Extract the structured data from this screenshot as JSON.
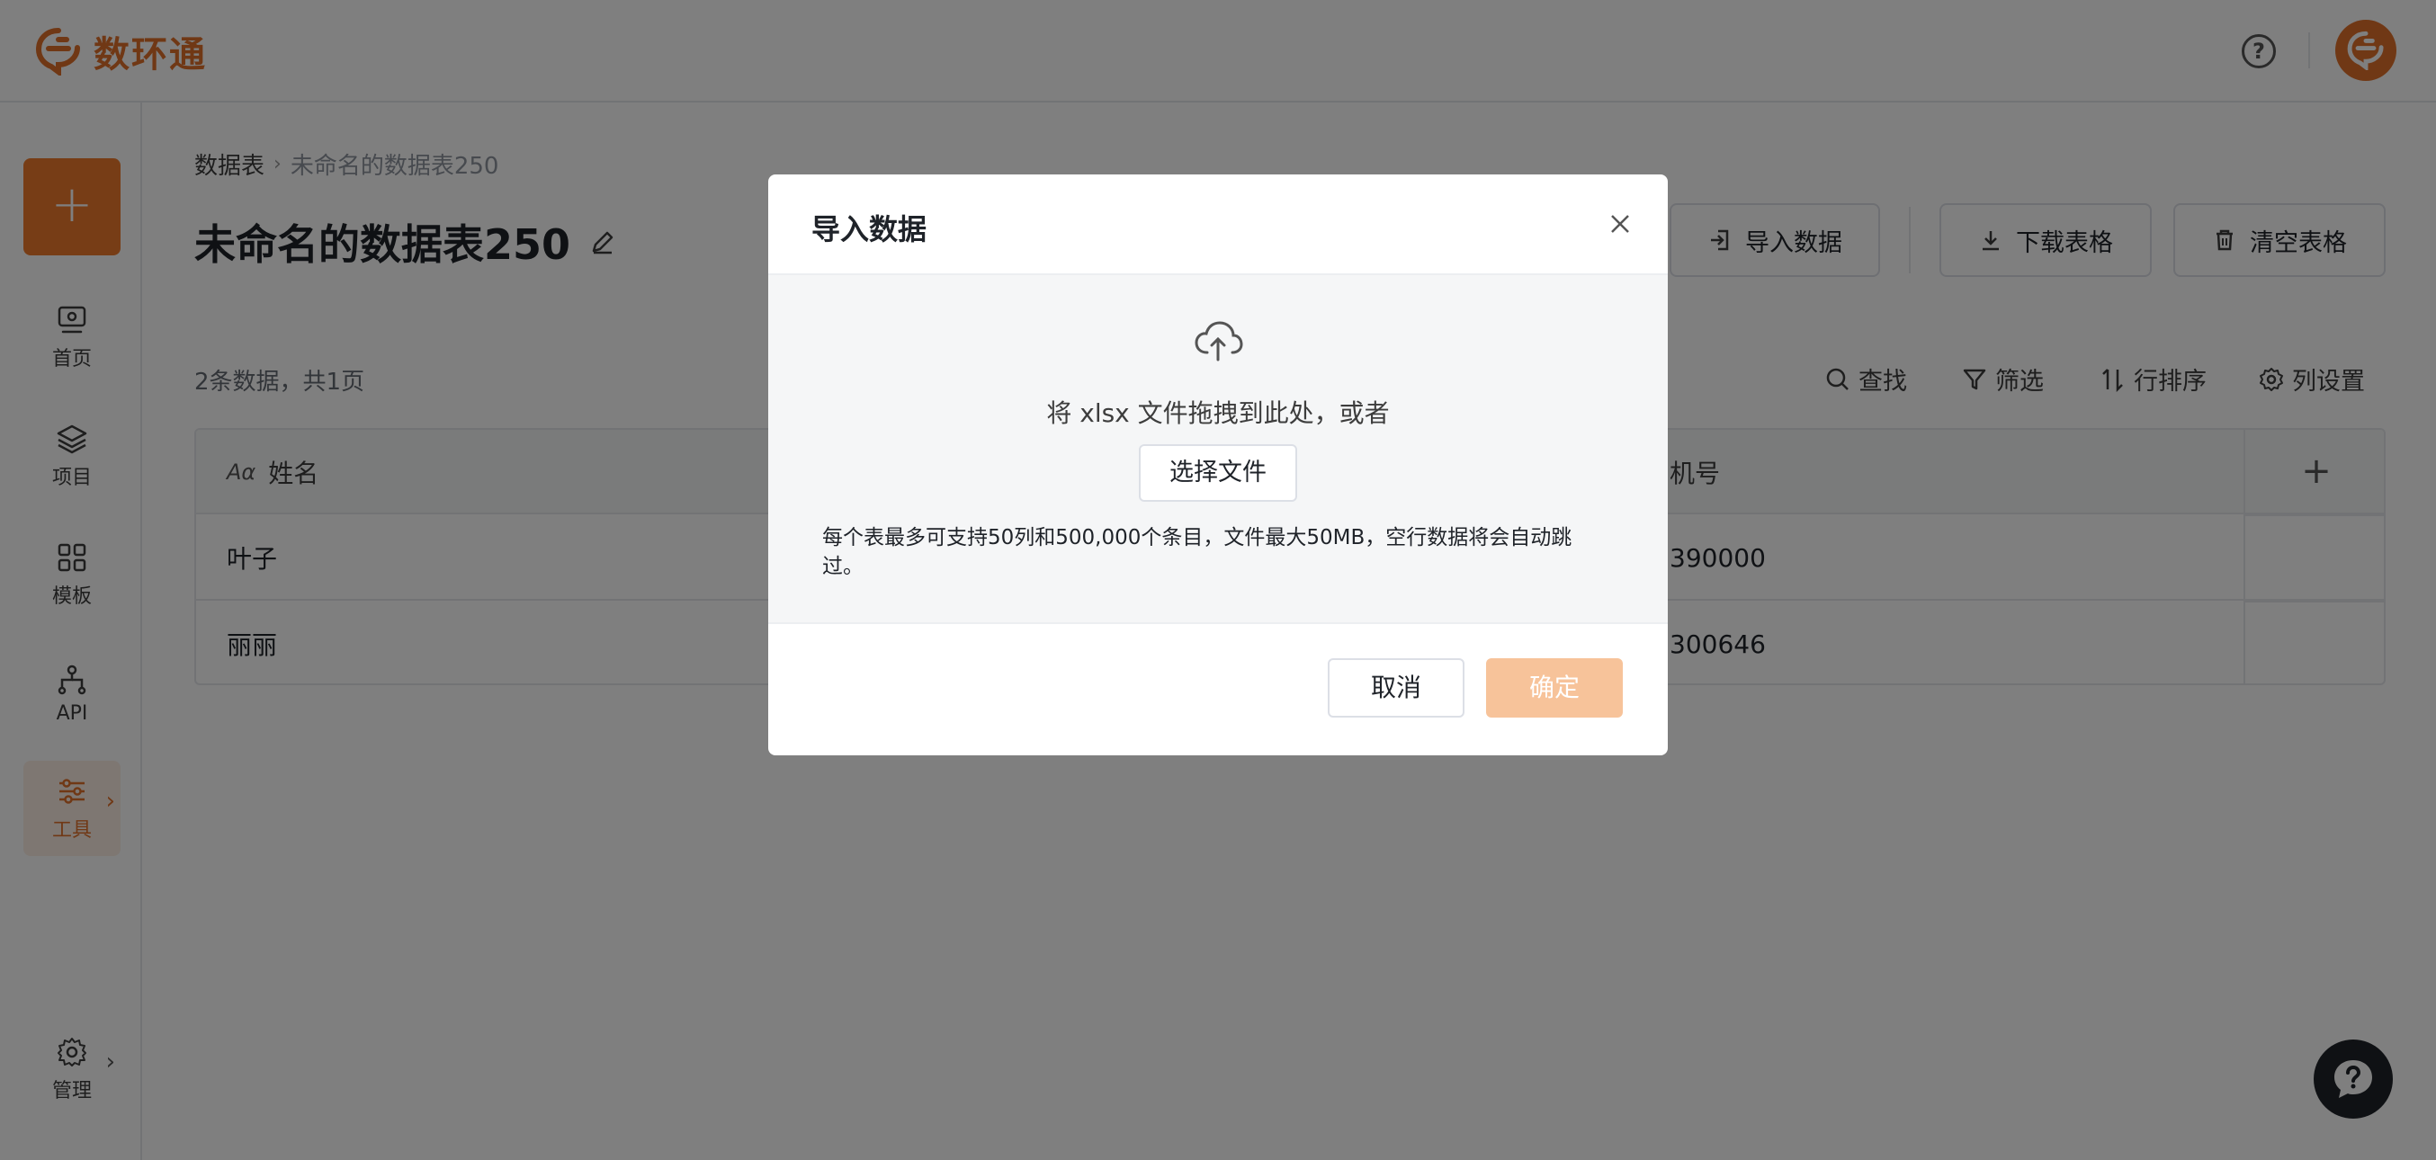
{
  "app": {
    "name": "数环通",
    "brand_color": "#e0702a"
  },
  "header": {
    "help_icon": "question-circle-icon",
    "avatar_icon": "brand-avatar-icon"
  },
  "sidebar": {
    "add_label": "+",
    "items": [
      {
        "label": "首页",
        "icon": "monitor-icon"
      },
      {
        "label": "项目",
        "icon": "layers-icon"
      },
      {
        "label": "模板",
        "icon": "grid-icon"
      },
      {
        "label": "API",
        "icon": "api-icon"
      },
      {
        "label": "工具",
        "icon": "sliders-icon",
        "active": true,
        "chevron": "›"
      },
      {
        "label": "管理",
        "icon": "gear-icon",
        "chevron": "›"
      }
    ]
  },
  "breadcrumb": {
    "root": "数据表",
    "separator": "›",
    "current": "未命名的数据表250"
  },
  "page": {
    "title": "未命名的数据表250"
  },
  "toolbar": {
    "import_label": "导入数据",
    "download_label": "下载表格",
    "clear_label": "清空表格"
  },
  "table_meta": {
    "count_text": "2条数据，共1页"
  },
  "table_tools": {
    "find": "查找",
    "filter": "筛选",
    "sort": "行排序",
    "columns": "列设置"
  },
  "table": {
    "columns": [
      {
        "type_glyph": "Aα",
        "label": "姓名"
      },
      {
        "type_glyph": "",
        "label": "机号"
      }
    ],
    "add_column": "+",
    "rows": [
      {
        "name": "叶子",
        "phone": "390000"
      },
      {
        "name": "丽丽",
        "phone": "300646"
      }
    ]
  },
  "modal": {
    "title": "导入数据",
    "drop_text": "将 xlsx 文件拖拽到此处，或者",
    "choose_label": "选择文件",
    "limit_text": "每个表最多可支持50列和500,000个条目，文件最大50MB，空行数据将会自动跳过。",
    "cancel_label": "取消",
    "ok_label": "确定"
  }
}
